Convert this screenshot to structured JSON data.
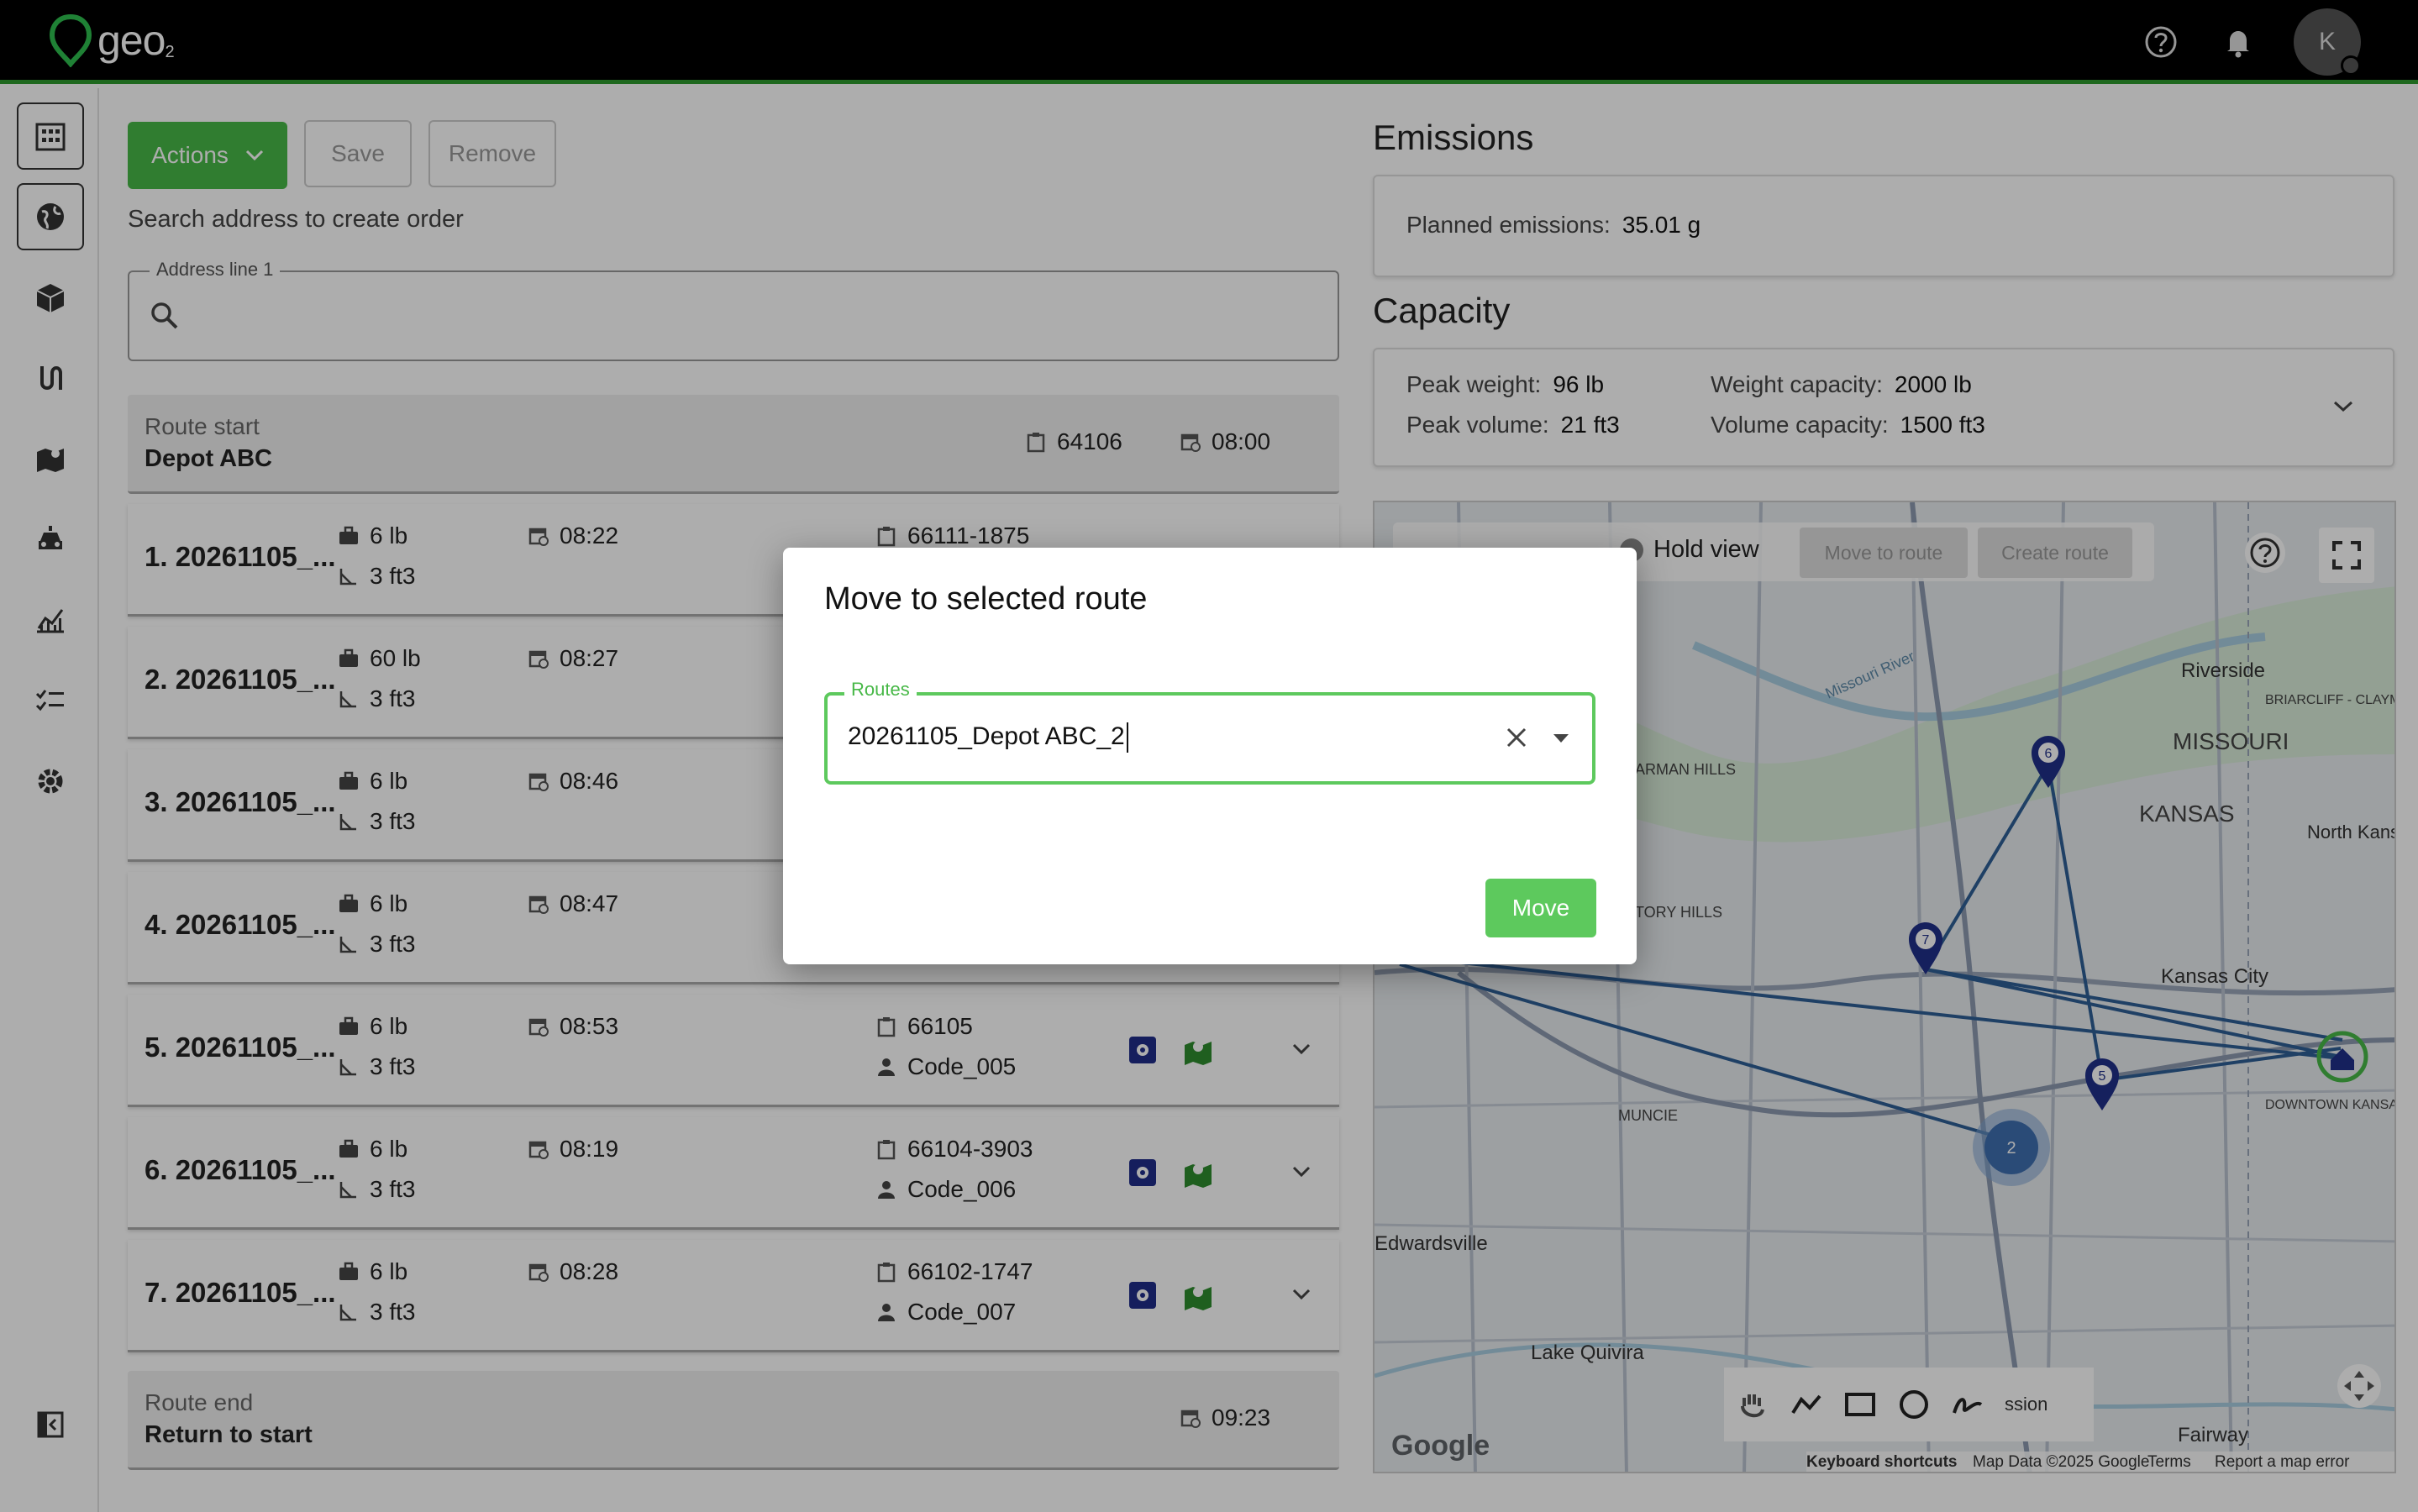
{
  "topbar": {
    "logo_text": "geo",
    "logo_sub": "2",
    "avatar_initial": "K",
    "icons": [
      "help-icon",
      "bell-icon"
    ]
  },
  "sidebar": {
    "items": [
      "building-icon",
      "globe-icon",
      "package-icon",
      "route-icon",
      "map-icon",
      "vehicle-icon",
      "chart-icon",
      "checklist-icon",
      "settings-icon"
    ],
    "collapse": "collapse-sidebar-icon"
  },
  "toolbar": {
    "actions_label": "Actions",
    "save_label": "Save",
    "remove_label": "Remove"
  },
  "search": {
    "hint": "Search address to create order",
    "address_label": "Address line 1",
    "address_value": ""
  },
  "route_start": {
    "label": "Route start",
    "name": "Depot ABC",
    "zip": "64106",
    "time": "08:00"
  },
  "stops": [
    {
      "title": "1. 20261105_...",
      "weight": "6 lb",
      "volume": "3 ft3",
      "time": "08:22",
      "zip": "66111-1875",
      "code": ""
    },
    {
      "title": "2. 20261105_...",
      "weight": "60 lb",
      "volume": "3 ft3",
      "time": "08:27",
      "zip": "",
      "code": ""
    },
    {
      "title": "3. 20261105_...",
      "weight": "6 lb",
      "volume": "3 ft3",
      "time": "08:46",
      "zip": "",
      "code": ""
    },
    {
      "title": "4. 20261105_...",
      "weight": "6 lb",
      "volume": "3 ft3",
      "time": "08:47",
      "zip": "",
      "code": ""
    },
    {
      "title": "5. 20261105_...",
      "weight": "6 lb",
      "volume": "3 ft3",
      "time": "08:53",
      "zip": "66105",
      "code": "Code_005"
    },
    {
      "title": "6. 20261105_...",
      "weight": "6 lb",
      "volume": "3 ft3",
      "time": "08:19",
      "zip": "66104-3903",
      "code": "Code_006"
    },
    {
      "title": "7. 20261105_...",
      "weight": "6 lb",
      "volume": "3 ft3",
      "time": "08:28",
      "zip": "66102-1747",
      "code": "Code_007"
    }
  ],
  "route_end": {
    "label": "Route end",
    "name": "Return to start",
    "time": "09:23"
  },
  "emissions": {
    "title": "Emissions",
    "label": "Planned emissions:",
    "value": "35.01 g"
  },
  "capacity": {
    "title": "Capacity",
    "peak_weight_label": "Peak weight:",
    "peak_weight": "96 lb",
    "peak_volume_label": "Peak volume:",
    "peak_volume": "21 ft3",
    "weight_capacity_label": "Weight capacity:",
    "weight_capacity": "2000 lb",
    "volume_capacity_label": "Volume capacity:",
    "volume_capacity": "1500 ft3"
  },
  "map": {
    "hold_view": "Hold view",
    "move_to_route": "Move to route",
    "create_route": "Create route",
    "places": [
      "MISSOURI",
      "KANSAS",
      "Riverside",
      "Kansas City",
      "North Kansas",
      "BRIARCLIFF - CLAYMONT",
      "MUNCIE",
      "Edwardsville",
      "Lake Quivira",
      "DOWNTOWN KANSAS CITY",
      "Fairway",
      "ARMAN HILLS",
      "TORY HILLS",
      "Missouri River"
    ],
    "markers": [
      "6",
      "7",
      "5",
      "2"
    ],
    "brand": "Google",
    "footer": [
      "Keyboard shortcuts",
      "Map Data ©2025 Google",
      "Terms",
      "Report a map error"
    ],
    "session_fragment": "ssion"
  },
  "dialog": {
    "title": "Move to selected route",
    "field_label": "Routes",
    "field_value": "20261105_Depot ABC_2",
    "move_label": "Move"
  },
  "colors": {
    "brand_green": "#47b847",
    "topbar": "#000000",
    "route_line": "#2e5f96"
  }
}
